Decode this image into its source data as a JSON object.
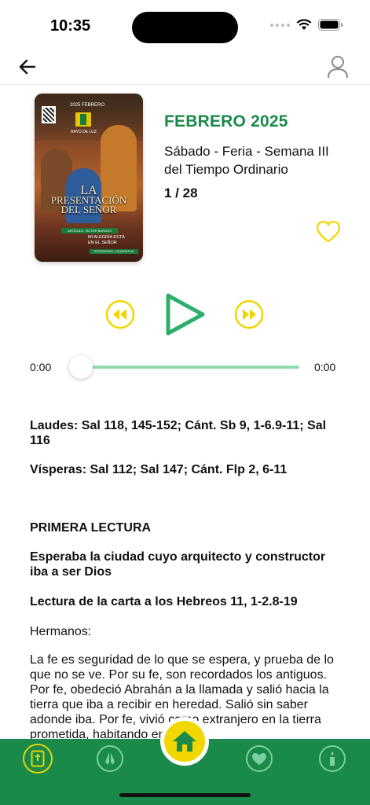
{
  "status_bar": {
    "time": "10:35"
  },
  "cover": {
    "date_text": "2025 FEBRERO",
    "brand": "RAYO DE LUZ",
    "title_line1": "LA",
    "title_line2": "PRESENTACIÓN",
    "title_line3": "DEL SEÑOR",
    "author": "ARTÍCULO: VÍCTOR BURGOS",
    "tagline_line1": "MI ALEGRÍA ESTÁ",
    "tagline_line2": "EN EL SEÑOR",
    "tag": "TESTIMONIO: LOURDES M."
  },
  "info": {
    "month": "FEBRERO 2025",
    "liturgy_line1": "Sábado - Feria - Semana III",
    "liturgy_line2": "del Tiempo Ordinario",
    "page_count": "1 / 28"
  },
  "player": {
    "current_time": "0:00",
    "total_time": "0:00",
    "progress": 0
  },
  "reading": {
    "laudes": "Laudes: Sal 118, 145-152; Cánt. Sb 9, 1-6.9-11; Sal 116",
    "visperas": "Vísperas: Sal 112; Sal 147; Cánt. Flp 2, 6-11",
    "section": "PRIMERA LECTURA",
    "title": "Esperaba la ciudad cuyo arquitecto y constructor iba a ser Dios",
    "citation": "Lectura de la carta a los Hebreos 11, 1-2.8-19",
    "greeting": "Hermanos:",
    "body": "La fe es seguridad de lo que se espera, y prueba de lo que no se ve. Por su fe, son recordados los antiguos. Por fe, obedeció Abrahán a la llamada y salió hacia la tierra que iba a recibir en heredad. Salió sin saber adonde iba. Por fe, vivió como extranjero en la tierra prometida, habitando en"
  },
  "colors": {
    "brand_green": "#1a8a4a",
    "accent_yellow": "#f2d600",
    "track_green": "#8fdcb2"
  },
  "icons": {
    "back": "arrow-left-icon",
    "profile": "user-icon",
    "favorite": "heart-outline-icon",
    "rewind": "rewind-icon",
    "play": "play-icon",
    "forward": "fast-forward-icon",
    "tabs": [
      "bible-icon",
      "prayer-hands-icon",
      "home-icon",
      "heart-icon",
      "candle-icon"
    ]
  }
}
